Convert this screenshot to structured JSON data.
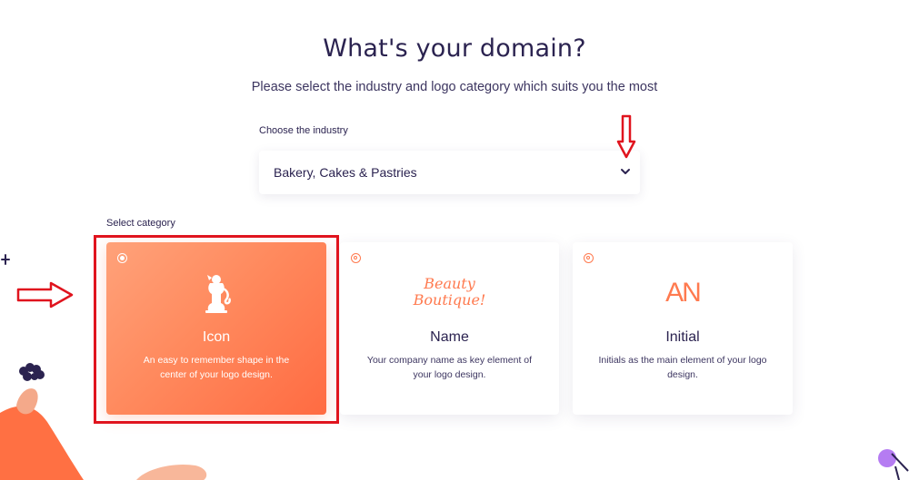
{
  "header": {
    "title": "What's your domain?",
    "subtitle": "Please select the industry and logo category which suits you the most"
  },
  "industry": {
    "label": "Choose the industry",
    "selected": "Bakery, Cakes & Pastries",
    "icon": "chevron-down-icon"
  },
  "category": {
    "label": "Select category",
    "cards": [
      {
        "title": "Icon",
        "description": "An easy to remember shape in the center of your logo design.",
        "selected": true,
        "visual_icon": "lion-crest-icon"
      },
      {
        "title": "Name",
        "description": "Your company name as key element of your logo design.",
        "selected": false,
        "visual_text": [
          "Beauty",
          "Boutique!"
        ]
      },
      {
        "title": "Initial",
        "description": "Initials as the main element of your logo design.",
        "selected": false,
        "visual_text": "AN"
      }
    ]
  },
  "colors": {
    "accent": "#ff7a4f",
    "text": "#2b2350",
    "annotation": "#e0141e",
    "selected_gradient": [
      "#ffa27a",
      "#ff6b42"
    ]
  }
}
